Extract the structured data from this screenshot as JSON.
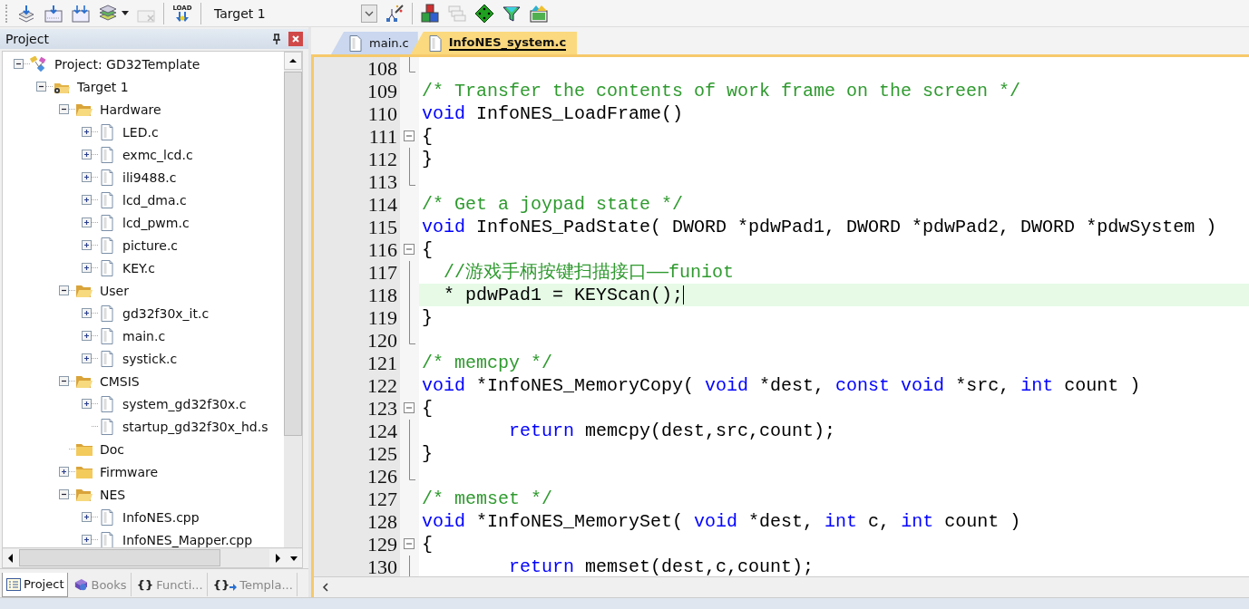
{
  "toolbar": {
    "load_label": "LOAD",
    "target": "Target 1"
  },
  "project_panel": {
    "title": "Project",
    "tree": [
      {
        "label": "Project: GD32Template",
        "kind": "project",
        "expanded": true,
        "children": [
          {
            "label": "Target 1",
            "kind": "target",
            "expanded": true,
            "children": [
              {
                "label": "Hardware",
                "kind": "group",
                "expanded": true,
                "children": [
                  {
                    "label": "LED.c",
                    "kind": "file",
                    "expanded": false
                  },
                  {
                    "label": "exmc_lcd.c",
                    "kind": "file",
                    "expanded": false
                  },
                  {
                    "label": "ili9488.c",
                    "kind": "file",
                    "expanded": false
                  },
                  {
                    "label": "lcd_dma.c",
                    "kind": "file",
                    "expanded": false
                  },
                  {
                    "label": "lcd_pwm.c",
                    "kind": "file",
                    "expanded": false
                  },
                  {
                    "label": "picture.c",
                    "kind": "file",
                    "expanded": false
                  },
                  {
                    "label": "KEY.c",
                    "kind": "file",
                    "expanded": false
                  }
                ]
              },
              {
                "label": "User",
                "kind": "group",
                "expanded": true,
                "children": [
                  {
                    "label": "gd32f30x_it.c",
                    "kind": "file",
                    "expanded": false
                  },
                  {
                    "label": "main.c",
                    "kind": "file",
                    "expanded": false
                  },
                  {
                    "label": "systick.c",
                    "kind": "file",
                    "expanded": false
                  }
                ]
              },
              {
                "label": "CMSIS",
                "kind": "group",
                "expanded": true,
                "children": [
                  {
                    "label": "system_gd32f30x.c",
                    "kind": "file",
                    "expanded": false
                  },
                  {
                    "label": "startup_gd32f30x_hd.s",
                    "kind": "file"
                  }
                ]
              },
              {
                "label": "Doc",
                "kind": "group"
              },
              {
                "label": "Firmware",
                "kind": "group",
                "expanded": false
              },
              {
                "label": "NES",
                "kind": "group",
                "expanded": true,
                "children": [
                  {
                    "label": "InfoNES.cpp",
                    "kind": "file",
                    "expanded": false
                  },
                  {
                    "label": "InfoNES_Mapper.cpp",
                    "kind": "file",
                    "expanded": false
                  }
                ]
              }
            ]
          }
        ]
      }
    ],
    "bottom_tabs": [
      {
        "label": "Project",
        "kind": "project",
        "selected": true
      },
      {
        "label": "Books",
        "kind": "books",
        "selected": false
      },
      {
        "label": "Functi...",
        "kind": "functions",
        "icon_text": "{}",
        "selected": false
      },
      {
        "label": "Templa...",
        "kind": "templates",
        "icon_text": "{}",
        "selected": false
      }
    ]
  },
  "editor": {
    "tabs": [
      {
        "label": "main.c",
        "selected": false
      },
      {
        "label": "InfoNES_system.c",
        "selected": true
      }
    ],
    "lines": [
      {
        "number": "108",
        "block_end": true,
        "current": false
      },
      {
        "number": "109",
        "block_end": false,
        "current": false,
        "tokens": [
          {
            "kind": "comment",
            "text": "/* Transfer the contents of work frame on the screen */"
          }
        ]
      },
      {
        "number": "110",
        "block_end": false,
        "current": false,
        "tokens": [
          {
            "kind": "keyword",
            "text": "void"
          },
          {
            "kind": "plain",
            "text": " InfoNES_LoadFrame()"
          }
        ]
      },
      {
        "number": "111",
        "expanded": true,
        "block_end": false,
        "current": false,
        "tokens": [
          {
            "kind": "plain",
            "text": "{"
          }
        ]
      },
      {
        "number": "112",
        "block_end": false,
        "current": false,
        "tokens": [
          {
            "kind": "plain",
            "text": "}"
          }
        ]
      },
      {
        "number": "113",
        "block_end": true,
        "current": false
      },
      {
        "number": "114",
        "block_end": false,
        "current": false,
        "tokens": [
          {
            "kind": "comment",
            "text": "/* Get a joypad state */"
          }
        ]
      },
      {
        "number": "115",
        "block_end": false,
        "current": false,
        "tokens": [
          {
            "kind": "keyword",
            "text": "void"
          },
          {
            "kind": "plain",
            "text": " InfoNES_PadState( DWORD *pdwPad1, DWORD *pdwPad2, DWORD *pdwSystem )"
          }
        ]
      },
      {
        "number": "116",
        "expanded": true,
        "block_end": false,
        "current": false,
        "tokens": [
          {
            "kind": "plain",
            "text": "{"
          }
        ]
      },
      {
        "number": "117",
        "block_end": false,
        "current": false,
        "tokens": [
          {
            "kind": "comment",
            "text": "  //游戏手柄按键扫描接口——funiot"
          }
        ]
      },
      {
        "number": "118",
        "block_end": false,
        "current": true,
        "tokens": [
          {
            "kind": "plain",
            "text": "  * pdwPad1 = KEYScan();"
          }
        ]
      },
      {
        "number": "119",
        "block_end": false,
        "current": false,
        "tokens": [
          {
            "kind": "plain",
            "text": "}"
          }
        ]
      },
      {
        "number": "120",
        "block_end": true,
        "current": false
      },
      {
        "number": "121",
        "block_end": false,
        "current": false,
        "tokens": [
          {
            "kind": "comment",
            "text": "/* memcpy */"
          }
        ]
      },
      {
        "number": "122",
        "block_end": false,
        "current": false,
        "tokens": [
          {
            "kind": "keyword",
            "text": "void"
          },
          {
            "kind": "plain",
            "text": " *InfoNES_MemoryCopy( "
          },
          {
            "kind": "keyword",
            "text": "void"
          },
          {
            "kind": "plain",
            "text": " *dest, "
          },
          {
            "kind": "keyword",
            "text": "const void"
          },
          {
            "kind": "plain",
            "text": " *src, "
          },
          {
            "kind": "keyword",
            "text": "int"
          },
          {
            "kind": "plain",
            "text": " count )"
          }
        ]
      },
      {
        "number": "123",
        "expanded": true,
        "block_end": false,
        "current": false,
        "tokens": [
          {
            "kind": "plain",
            "text": "{"
          }
        ]
      },
      {
        "number": "124",
        "block_end": false,
        "current": false,
        "tokens": [
          {
            "kind": "keyword",
            "text": "        return"
          },
          {
            "kind": "plain",
            "text": " memcpy(dest,src,count);"
          }
        ]
      },
      {
        "number": "125",
        "block_end": false,
        "current": false,
        "tokens": [
          {
            "kind": "plain",
            "text": "}"
          }
        ]
      },
      {
        "number": "126",
        "block_end": true,
        "current": false
      },
      {
        "number": "127",
        "block_end": false,
        "current": false,
        "tokens": [
          {
            "kind": "comment",
            "text": "/* memset */"
          }
        ]
      },
      {
        "number": "128",
        "block_end": false,
        "current": false,
        "tokens": [
          {
            "kind": "keyword",
            "text": "void"
          },
          {
            "kind": "plain",
            "text": " *InfoNES_MemorySet( "
          },
          {
            "kind": "keyword",
            "text": "void"
          },
          {
            "kind": "plain",
            "text": " *dest, "
          },
          {
            "kind": "keyword",
            "text": "int"
          },
          {
            "kind": "plain",
            "text": " c, "
          },
          {
            "kind": "keyword",
            "text": "int"
          },
          {
            "kind": "plain",
            "text": " count )"
          }
        ]
      },
      {
        "number": "129",
        "expanded": true,
        "block_end": false,
        "current": false,
        "tokens": [
          {
            "kind": "plain",
            "text": "{"
          }
        ]
      },
      {
        "number": "130",
        "block_end": false,
        "current": false,
        "tokens": [
          {
            "kind": "keyword",
            "text": "        return"
          },
          {
            "kind": "plain",
            "text": " memset(dest,c,count);"
          }
        ]
      }
    ]
  }
}
